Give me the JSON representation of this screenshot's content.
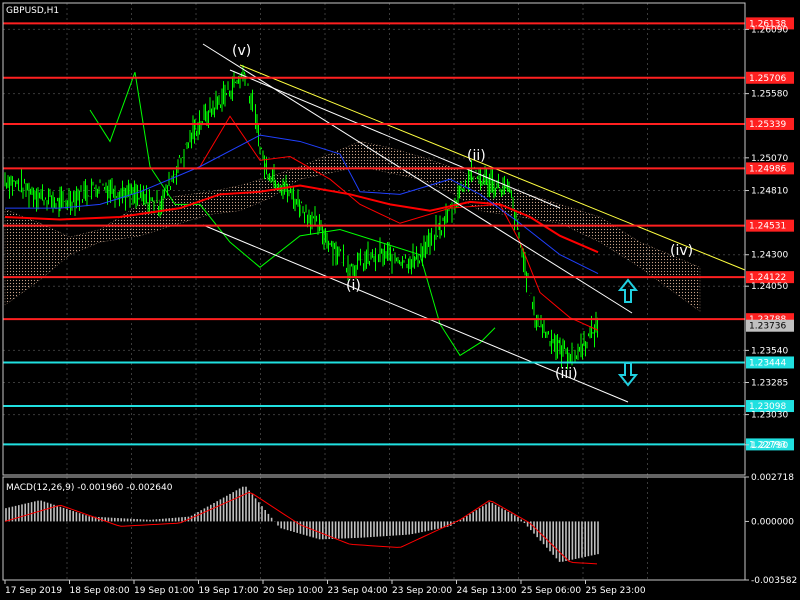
{
  "window": {
    "title": "GBPUSD,H1"
  },
  "macd": {
    "label": "MACD(12,26,9) -0.001960 -0.002640"
  },
  "colors": {
    "background": "#000000",
    "grid": "#3a3a3a",
    "frame": "#c8c8c8",
    "resistance": "#ff2020",
    "support": "#20e0e0",
    "price": "#00ff00",
    "ma_red": "#ff0000",
    "ma_blue": "#2040ff",
    "cloud_dots": "#ffd0b0",
    "channel": "#ffffff",
    "yellow_line": "#ffff40",
    "arrow": "#20d0e0",
    "macd_hist": "#c0c0c0",
    "macd_signal": "#ff0000"
  },
  "chart_data": {
    "type": "candlestick",
    "symbol": "GBPUSD",
    "timeframe": "H1",
    "x_labels": [
      "17 Sep 2019",
      "18 Sep 08:00",
      "19 Sep 01:00",
      "19 Sep 17:00",
      "20 Sep 10:00",
      "23 Sep 04:00",
      "23 Sep 20:00",
      "24 Sep 13:00",
      "25 Sep 06:00",
      "25 Sep 23:00"
    ],
    "y_ticks": [
      "1.26090",
      "1.25580",
      "1.25070",
      "1.24810",
      "1.24300",
      "1.24050",
      "1.23540",
      "1.23285",
      "1.23030",
      "1.22790"
    ],
    "price_levels": [
      {
        "value": "1.26138",
        "kind": "resistance"
      },
      {
        "value": "1.25706",
        "kind": "resistance"
      },
      {
        "value": "1.25339",
        "kind": "resistance"
      },
      {
        "value": "1.24986",
        "kind": "resistance"
      },
      {
        "value": "1.24531",
        "kind": "resistance"
      },
      {
        "value": "1.24122",
        "kind": "resistance"
      },
      {
        "value": "1.23788",
        "kind": "resistance"
      },
      {
        "value": "1.23444",
        "kind": "support"
      },
      {
        "value": "1.23098",
        "kind": "support"
      },
      {
        "value": "1.22793",
        "kind": "support"
      }
    ],
    "current_price": "1.23736",
    "wave_labels": [
      "(v)",
      "(i)",
      "(ii)",
      "(iii)",
      "(iv)"
    ],
    "arrows": [
      "up",
      "down"
    ],
    "macd_ticks": [
      "0.002718",
      "0.000000",
      "-0.003582"
    ],
    "macd": {
      "fast": 12,
      "slow": 26,
      "signal": 9,
      "main": -0.00196,
      "signal_value": -0.00264
    }
  }
}
